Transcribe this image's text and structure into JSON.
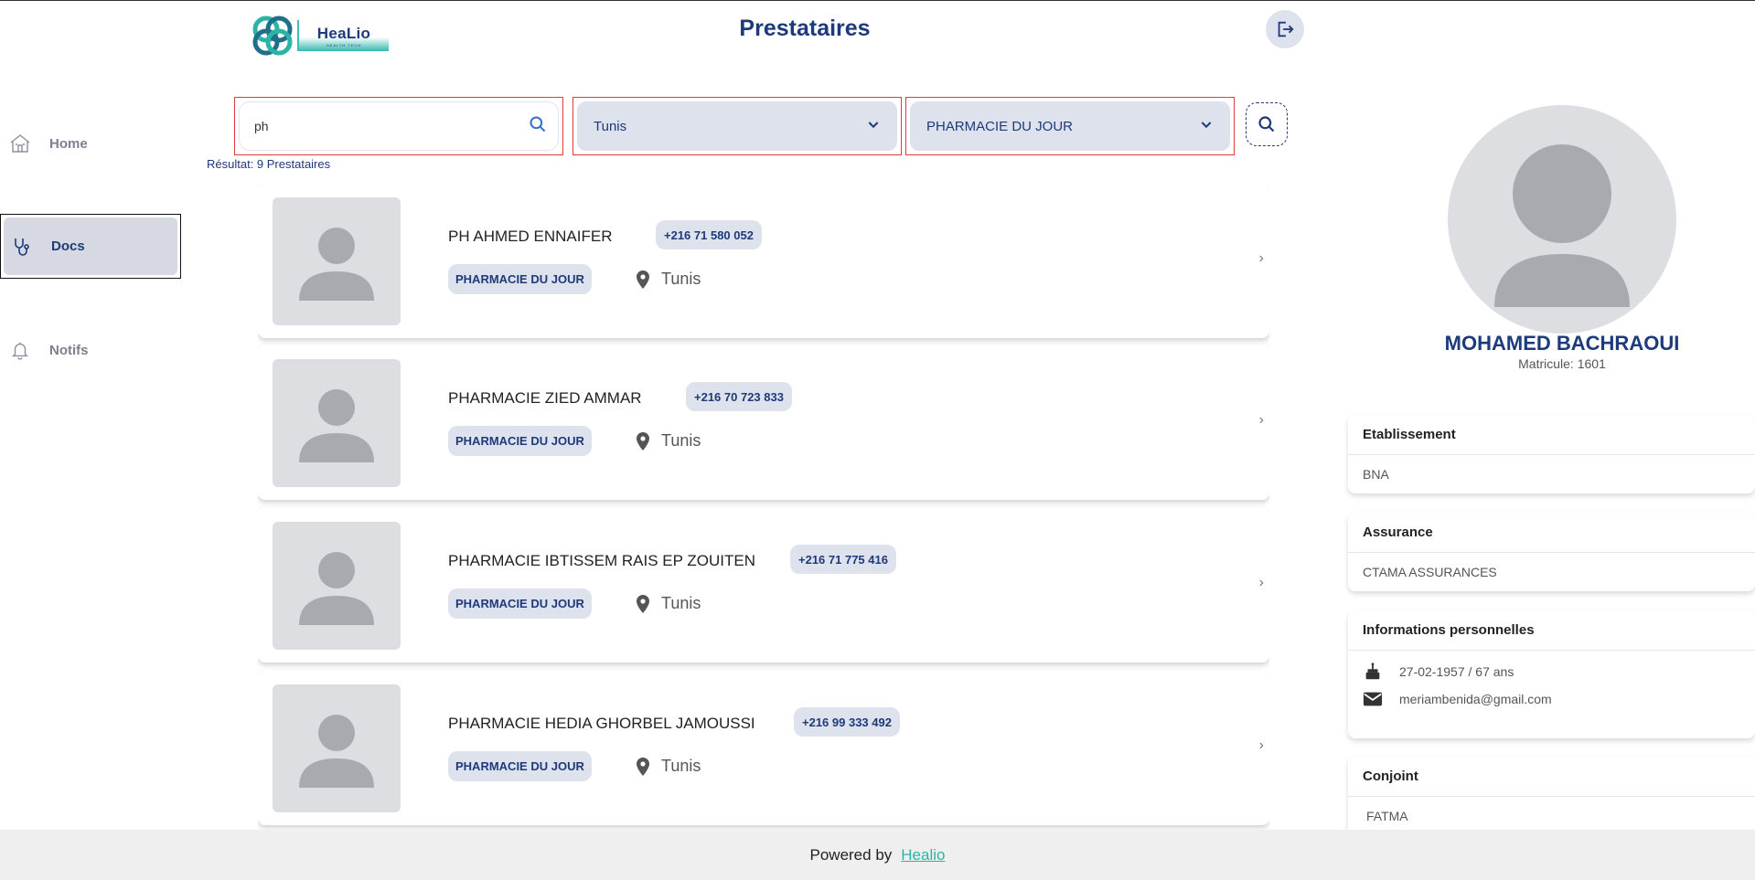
{
  "app": {
    "brand": "HeaLio",
    "brand_tagline": "HEALTH TECH",
    "page_title": "Prestataires"
  },
  "sidebar": {
    "items": [
      {
        "label": "Home",
        "icon": "home-icon",
        "active": false
      },
      {
        "label": "Docs",
        "icon": "stethoscope-icon",
        "active": true
      },
      {
        "label": "Notifs",
        "icon": "bell-icon",
        "active": false
      }
    ]
  },
  "filters": {
    "search_value": "ph",
    "city": "Tunis",
    "type": "PHARMACIE DU JOUR",
    "result_text": "Résultat: 9 Prestataires"
  },
  "providers": [
    {
      "name": "PH AHMED ENNAIFER",
      "phone": "+216 71 580 052",
      "type": "PHARMACIE DU JOUR",
      "city": "Tunis"
    },
    {
      "name": "PHARMACIE ZIED AMMAR",
      "phone": "+216 70 723 833",
      "type": "PHARMACIE DU JOUR",
      "city": "Tunis"
    },
    {
      "name": "PHARMACIE IBTISSEM RAIS EP ZOUITEN",
      "phone": "+216 71 775 416",
      "type": "PHARMACIE DU JOUR",
      "city": "Tunis"
    },
    {
      "name": "PHARMACIE HEDIA GHORBEL JAMOUSSI",
      "phone": "+216 99 333 492",
      "type": "PHARMACIE DU JOUR",
      "city": "Tunis"
    }
  ],
  "profile": {
    "name": "MOHAMED BACHRAOUI",
    "matricule": "Matricule: 1601",
    "etablissement_title": "Etablissement",
    "etablissement_value": "BNA",
    "assurance_title": "Assurance",
    "assurance_value": "CTAMA ASSURANCES",
    "info_title": "Informations personnelles",
    "birth": "27-02-1957 / 67 ans",
    "email": "meriambenida@gmail.com",
    "conjoint_title": "Conjoint",
    "conjoint_value": "FATMA"
  },
  "footer": {
    "powered_by": "Powered by",
    "brand_link": "Healio"
  },
  "colors": {
    "primary": "#1e3a7b",
    "accent": "#2bb3a6",
    "chip_bg": "#dde2ec",
    "highlight_border": "#e23b3b"
  }
}
